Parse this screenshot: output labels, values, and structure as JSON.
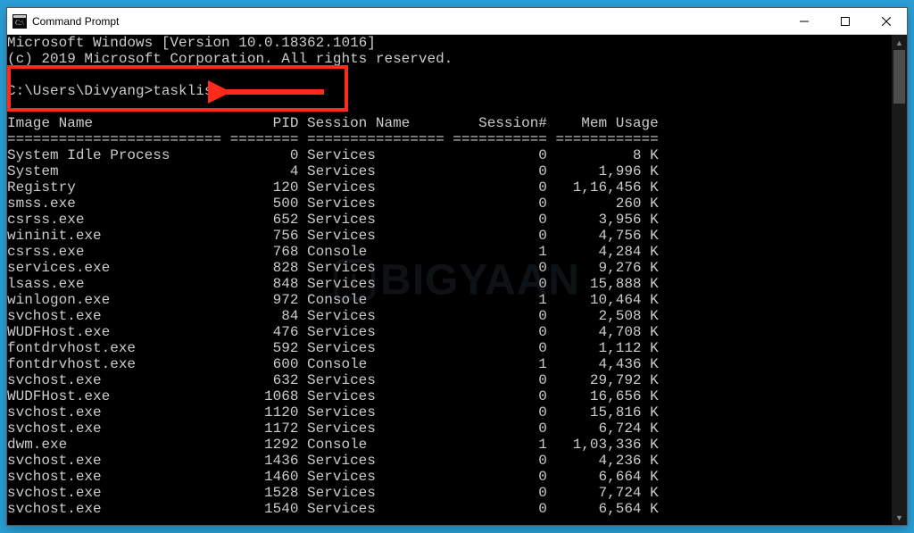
{
  "window_title": "Command Prompt",
  "version_line": "Microsoft Windows [Version 10.0.18362.1016]",
  "copyright_line": "(c) 2019 Microsoft Corporation. All rights reserved.",
  "prompt_path": "C:\\Users\\Divyang>",
  "command": "tasklist",
  "headers": {
    "image_name": "Image Name",
    "pid": "PID",
    "session_name": "Session Name",
    "session_num": "Session#",
    "mem_usage": "Mem Usage"
  },
  "separator": "========================= ======== ================ =========== ============",
  "processes": [
    {
      "name": "System Idle Process",
      "pid": 0,
      "session": "Services",
      "snum": 0,
      "mem": "8 K"
    },
    {
      "name": "System",
      "pid": 4,
      "session": "Services",
      "snum": 0,
      "mem": "1,996 K"
    },
    {
      "name": "Registry",
      "pid": 120,
      "session": "Services",
      "snum": 0,
      "mem": "1,16,456 K"
    },
    {
      "name": "smss.exe",
      "pid": 500,
      "session": "Services",
      "snum": 0,
      "mem": "260 K"
    },
    {
      "name": "csrss.exe",
      "pid": 652,
      "session": "Services",
      "snum": 0,
      "mem": "3,956 K"
    },
    {
      "name": "wininit.exe",
      "pid": 756,
      "session": "Services",
      "snum": 0,
      "mem": "4,756 K"
    },
    {
      "name": "csrss.exe",
      "pid": 768,
      "session": "Console",
      "snum": 1,
      "mem": "4,284 K"
    },
    {
      "name": "services.exe",
      "pid": 828,
      "session": "Services",
      "snum": 0,
      "mem": "9,276 K"
    },
    {
      "name": "lsass.exe",
      "pid": 848,
      "session": "Services",
      "snum": 0,
      "mem": "15,888 K"
    },
    {
      "name": "winlogon.exe",
      "pid": 972,
      "session": "Console",
      "snum": 1,
      "mem": "10,464 K"
    },
    {
      "name": "svchost.exe",
      "pid": 84,
      "session": "Services",
      "snum": 0,
      "mem": "2,508 K"
    },
    {
      "name": "WUDFHost.exe",
      "pid": 476,
      "session": "Services",
      "snum": 0,
      "mem": "4,708 K"
    },
    {
      "name": "fontdrvhost.exe",
      "pid": 592,
      "session": "Services",
      "snum": 0,
      "mem": "1,112 K"
    },
    {
      "name": "fontdrvhost.exe",
      "pid": 600,
      "session": "Console",
      "snum": 1,
      "mem": "4,436 K"
    },
    {
      "name": "svchost.exe",
      "pid": 632,
      "session": "Services",
      "snum": 0,
      "mem": "29,792 K"
    },
    {
      "name": "WUDFHost.exe",
      "pid": 1068,
      "session": "Services",
      "snum": 0,
      "mem": "16,656 K"
    },
    {
      "name": "svchost.exe",
      "pid": 1120,
      "session": "Services",
      "snum": 0,
      "mem": "15,816 K"
    },
    {
      "name": "svchost.exe",
      "pid": 1172,
      "session": "Services",
      "snum": 0,
      "mem": "6,724 K"
    },
    {
      "name": "dwm.exe",
      "pid": 1292,
      "session": "Console",
      "snum": 1,
      "mem": "1,03,336 K"
    },
    {
      "name": "svchost.exe",
      "pid": 1436,
      "session": "Services",
      "snum": 0,
      "mem": "4,236 K"
    },
    {
      "name": "svchost.exe",
      "pid": 1460,
      "session": "Services",
      "snum": 0,
      "mem": "6,664 K"
    },
    {
      "name": "svchost.exe",
      "pid": 1528,
      "session": "Services",
      "snum": 0,
      "mem": "7,724 K"
    },
    {
      "name": "svchost.exe",
      "pid": 1540,
      "session": "Services",
      "snum": 0,
      "mem": "6,564 K"
    }
  ],
  "watermark_text": "BIGYAAN",
  "annotation_color": "#ff2a1a"
}
